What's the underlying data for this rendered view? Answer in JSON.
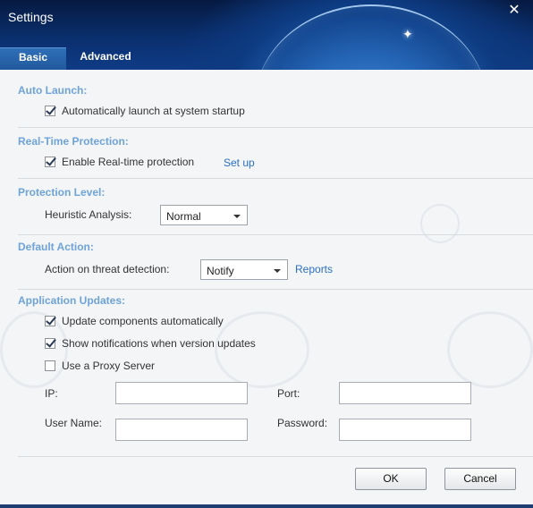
{
  "window": {
    "title": "Settings",
    "close_symbol": "✕"
  },
  "tabs": [
    {
      "label": "Basic",
      "active": true
    },
    {
      "label": "Advanced",
      "active": false
    }
  ],
  "auto_launch": {
    "title": "Auto Launch:",
    "startup": {
      "label": "Automatically launch at system startup",
      "checked": true
    }
  },
  "realtime": {
    "title": "Real-Time Protection:",
    "enable": {
      "label": "Enable Real-time protection",
      "checked": true
    },
    "setup_link": "Set up"
  },
  "protection_level": {
    "title": "Protection Level:",
    "heuristic_label": "Heuristic Analysis:",
    "heuristic_value": "Normal"
  },
  "default_action": {
    "title": "Default Action:",
    "threat_label": "Action on threat detection:",
    "threat_value": "Notify",
    "reports_link": "Reports"
  },
  "updates": {
    "title": "Application Updates:",
    "auto_update": {
      "label": "Update components automatically",
      "checked": true
    },
    "notify": {
      "label": "Show notifications when version updates",
      "checked": true
    },
    "proxy": {
      "label": "Use a Proxy Server",
      "checked": false
    },
    "ip_label": "IP:",
    "ip_value": "",
    "port_label": "Port:",
    "port_value": "",
    "user_label": "User Name:",
    "user_value": "",
    "password_label": "Password:",
    "password_value": ""
  },
  "buttons": {
    "ok": "OK",
    "cancel": "Cancel"
  },
  "colors": {
    "section_title": "#6fa3db",
    "link": "#2a6fc2",
    "header_bg": "#0b2f6e",
    "content_bg": "#f3f5f7"
  }
}
